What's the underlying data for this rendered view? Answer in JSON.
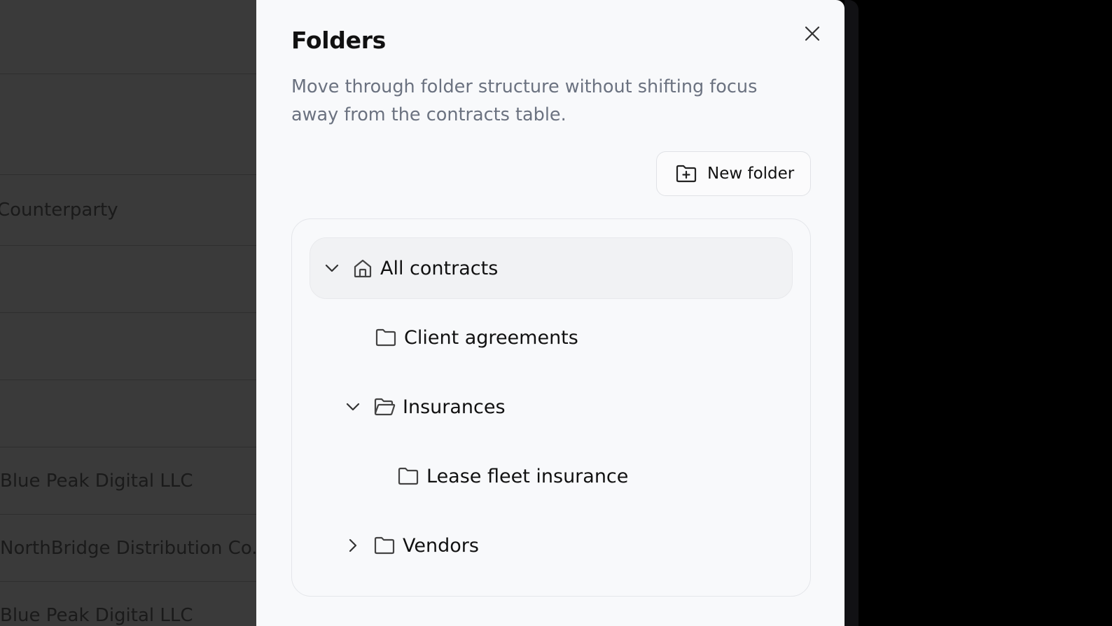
{
  "background": {
    "rows": [
      {
        "text": ""
      },
      {
        "text": ""
      },
      {
        "text": "Counterparty"
      },
      {
        "text": ""
      },
      {
        "text": ""
      },
      {
        "text": ""
      },
      {
        "text": "Blue Peak Digital LLC"
      },
      {
        "text": "NorthBridge Distribution Co."
      },
      {
        "text": "Blue Peak Digital LLC"
      }
    ]
  },
  "drawer": {
    "title": "Folders",
    "description": "Move through folder structure without shifting focus away from the contracts table.",
    "new_folder_label": "New folder",
    "tree": {
      "root": {
        "label": "All contracts",
        "expanded": true,
        "icon": "home-icon"
      },
      "children": [
        {
          "label": "Client agreements",
          "icon": "folder-icon"
        },
        {
          "label": "Insurances",
          "icon": "folder-open-icon",
          "expanded": true
        },
        {
          "label": "Lease fleet insurance",
          "icon": "folder-icon"
        },
        {
          "label": "Vendors",
          "icon": "folder-icon",
          "expanded": false
        }
      ]
    }
  },
  "colors": {
    "drawer_bg": "#f8f9fb",
    "overlay_bg": "#3a3a3a",
    "text_primary": "#111111",
    "text_muted": "#6b7280"
  }
}
